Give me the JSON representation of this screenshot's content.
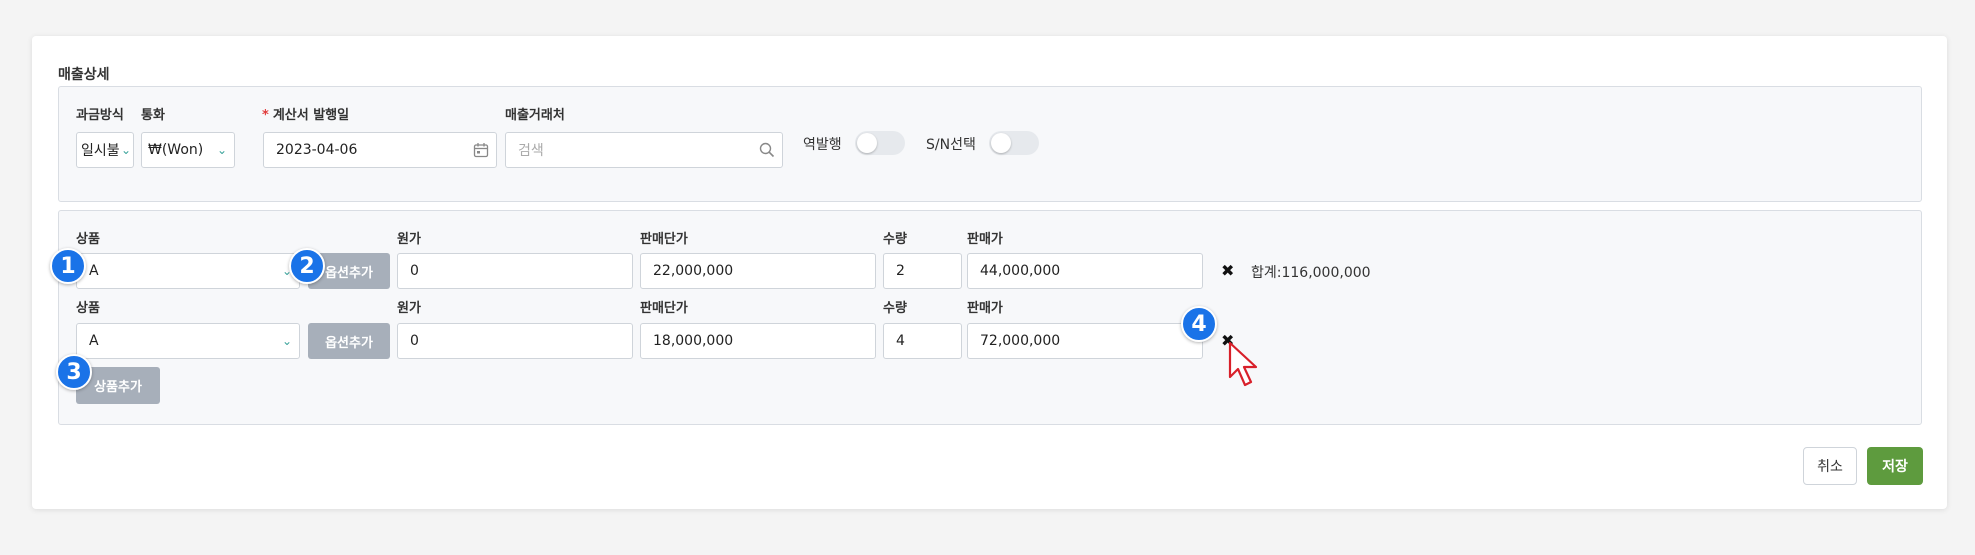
{
  "section_title": "매출상세",
  "header": {
    "billing_label": "과금방식",
    "billing_value": "일시불",
    "currency_label": "통화",
    "currency_value": "₩(Won)",
    "required_mark": "*",
    "issue_date_label": "계산서 발행일",
    "issue_date_value": "2023-04-06",
    "client_label": "매출거래처",
    "client_placeholder": "검색",
    "reverse_issue_label": "역발행",
    "sn_select_label": "S/N선택"
  },
  "product_rows": [
    {
      "product_label": "상품",
      "product_value": "A",
      "option_add_label": "옵션추가",
      "cost_label": "원가",
      "cost_value": "0",
      "unit_price_label": "판매단가",
      "unit_price_value": "22,000,000",
      "qty_label": "수량",
      "qty_value": "2",
      "sale_price_label": "판매가",
      "sale_price_value": "44,000,000"
    },
    {
      "product_label": "상품",
      "product_value": "A",
      "option_add_label": "옵션추가",
      "cost_label": "원가",
      "cost_value": "0",
      "unit_price_label": "판매단가",
      "unit_price_value": "18,000,000",
      "qty_label": "수량",
      "qty_value": "4",
      "sale_price_label": "판매가",
      "sale_price_value": "72,000,000"
    }
  ],
  "total_text": "합계:116,000,000",
  "remove_icon": "✖",
  "add_product_label": "상품추가",
  "badges": [
    "1",
    "2",
    "3",
    "4"
  ],
  "footer": {
    "cancel_label": "취소",
    "save_label": "저장"
  },
  "colors": {
    "save_green": "#5e9b3e",
    "badge_blue": "#1a73e8",
    "gray_button": "#a7afba",
    "required_red": "#e03a3a",
    "chevron_teal": "#3aa39b"
  }
}
